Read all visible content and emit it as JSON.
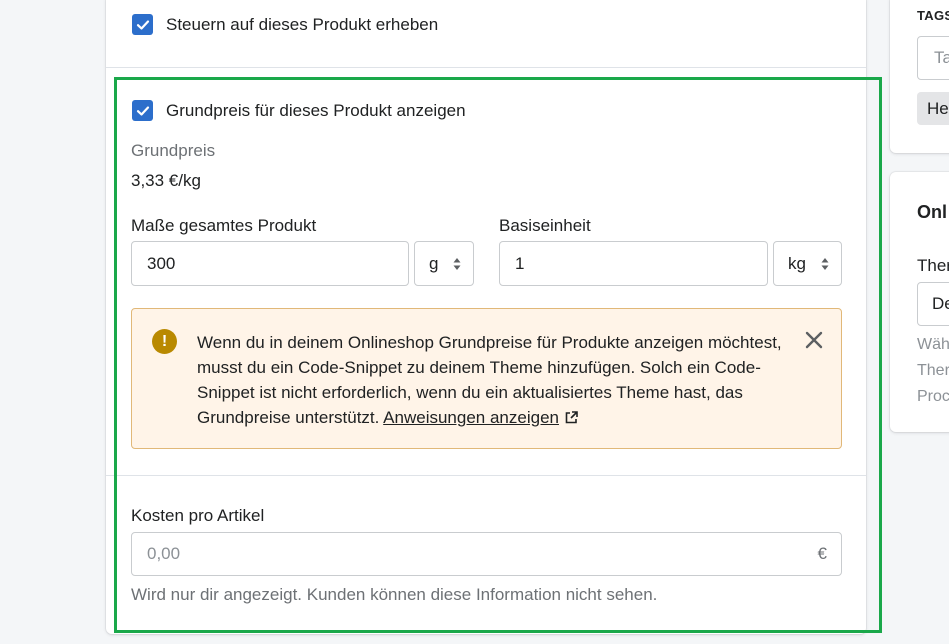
{
  "tax": {
    "label": "Steuern auf dieses Produkt erheben",
    "checked": true
  },
  "unit_price": {
    "checkbox_label": "Grundpreis für dieses Produkt anzeigen",
    "checked": true,
    "title": "Grundpreis",
    "value": "3,33 €/kg",
    "total_label": "Maße gesamtes Produkt",
    "total_value": "300",
    "total_unit": "g",
    "base_label": "Basiseinheit",
    "base_value": "1",
    "base_unit": "kg"
  },
  "banner": {
    "text": "Wenn du in deinem Onlineshop Grundpreise für Produkte anzeigen möchtest, musst du ein Code-Snippet zu deinem Theme hinzufügen. Solch ein Code-Snippet ist nicht erforderlich, wenn du ein aktualisiertes Theme hast, das Grundpreise unterstützt.",
    "link": "Anweisungen anzeigen",
    "icon": "warning-icon",
    "color": "#fff4e8"
  },
  "cost": {
    "label": "Kosten pro Artikel",
    "placeholder": "0,00",
    "currency": "€",
    "hint": "Wird nur dir angezeigt. Kunden können diese Information nicht sehen."
  },
  "sidebar": {
    "tags_heading": "TAGS",
    "tags_input": "Ta",
    "tag_chip": "He",
    "online_heading": "Onl",
    "theme_label": "Ther",
    "theme_select": "De",
    "help_lines": [
      "Wäh",
      "Ther",
      "Proc"
    ]
  },
  "colors": {
    "accent": "#2c6ecb",
    "highlight": "#1aa84a",
    "warning_border": "#e1b878"
  }
}
